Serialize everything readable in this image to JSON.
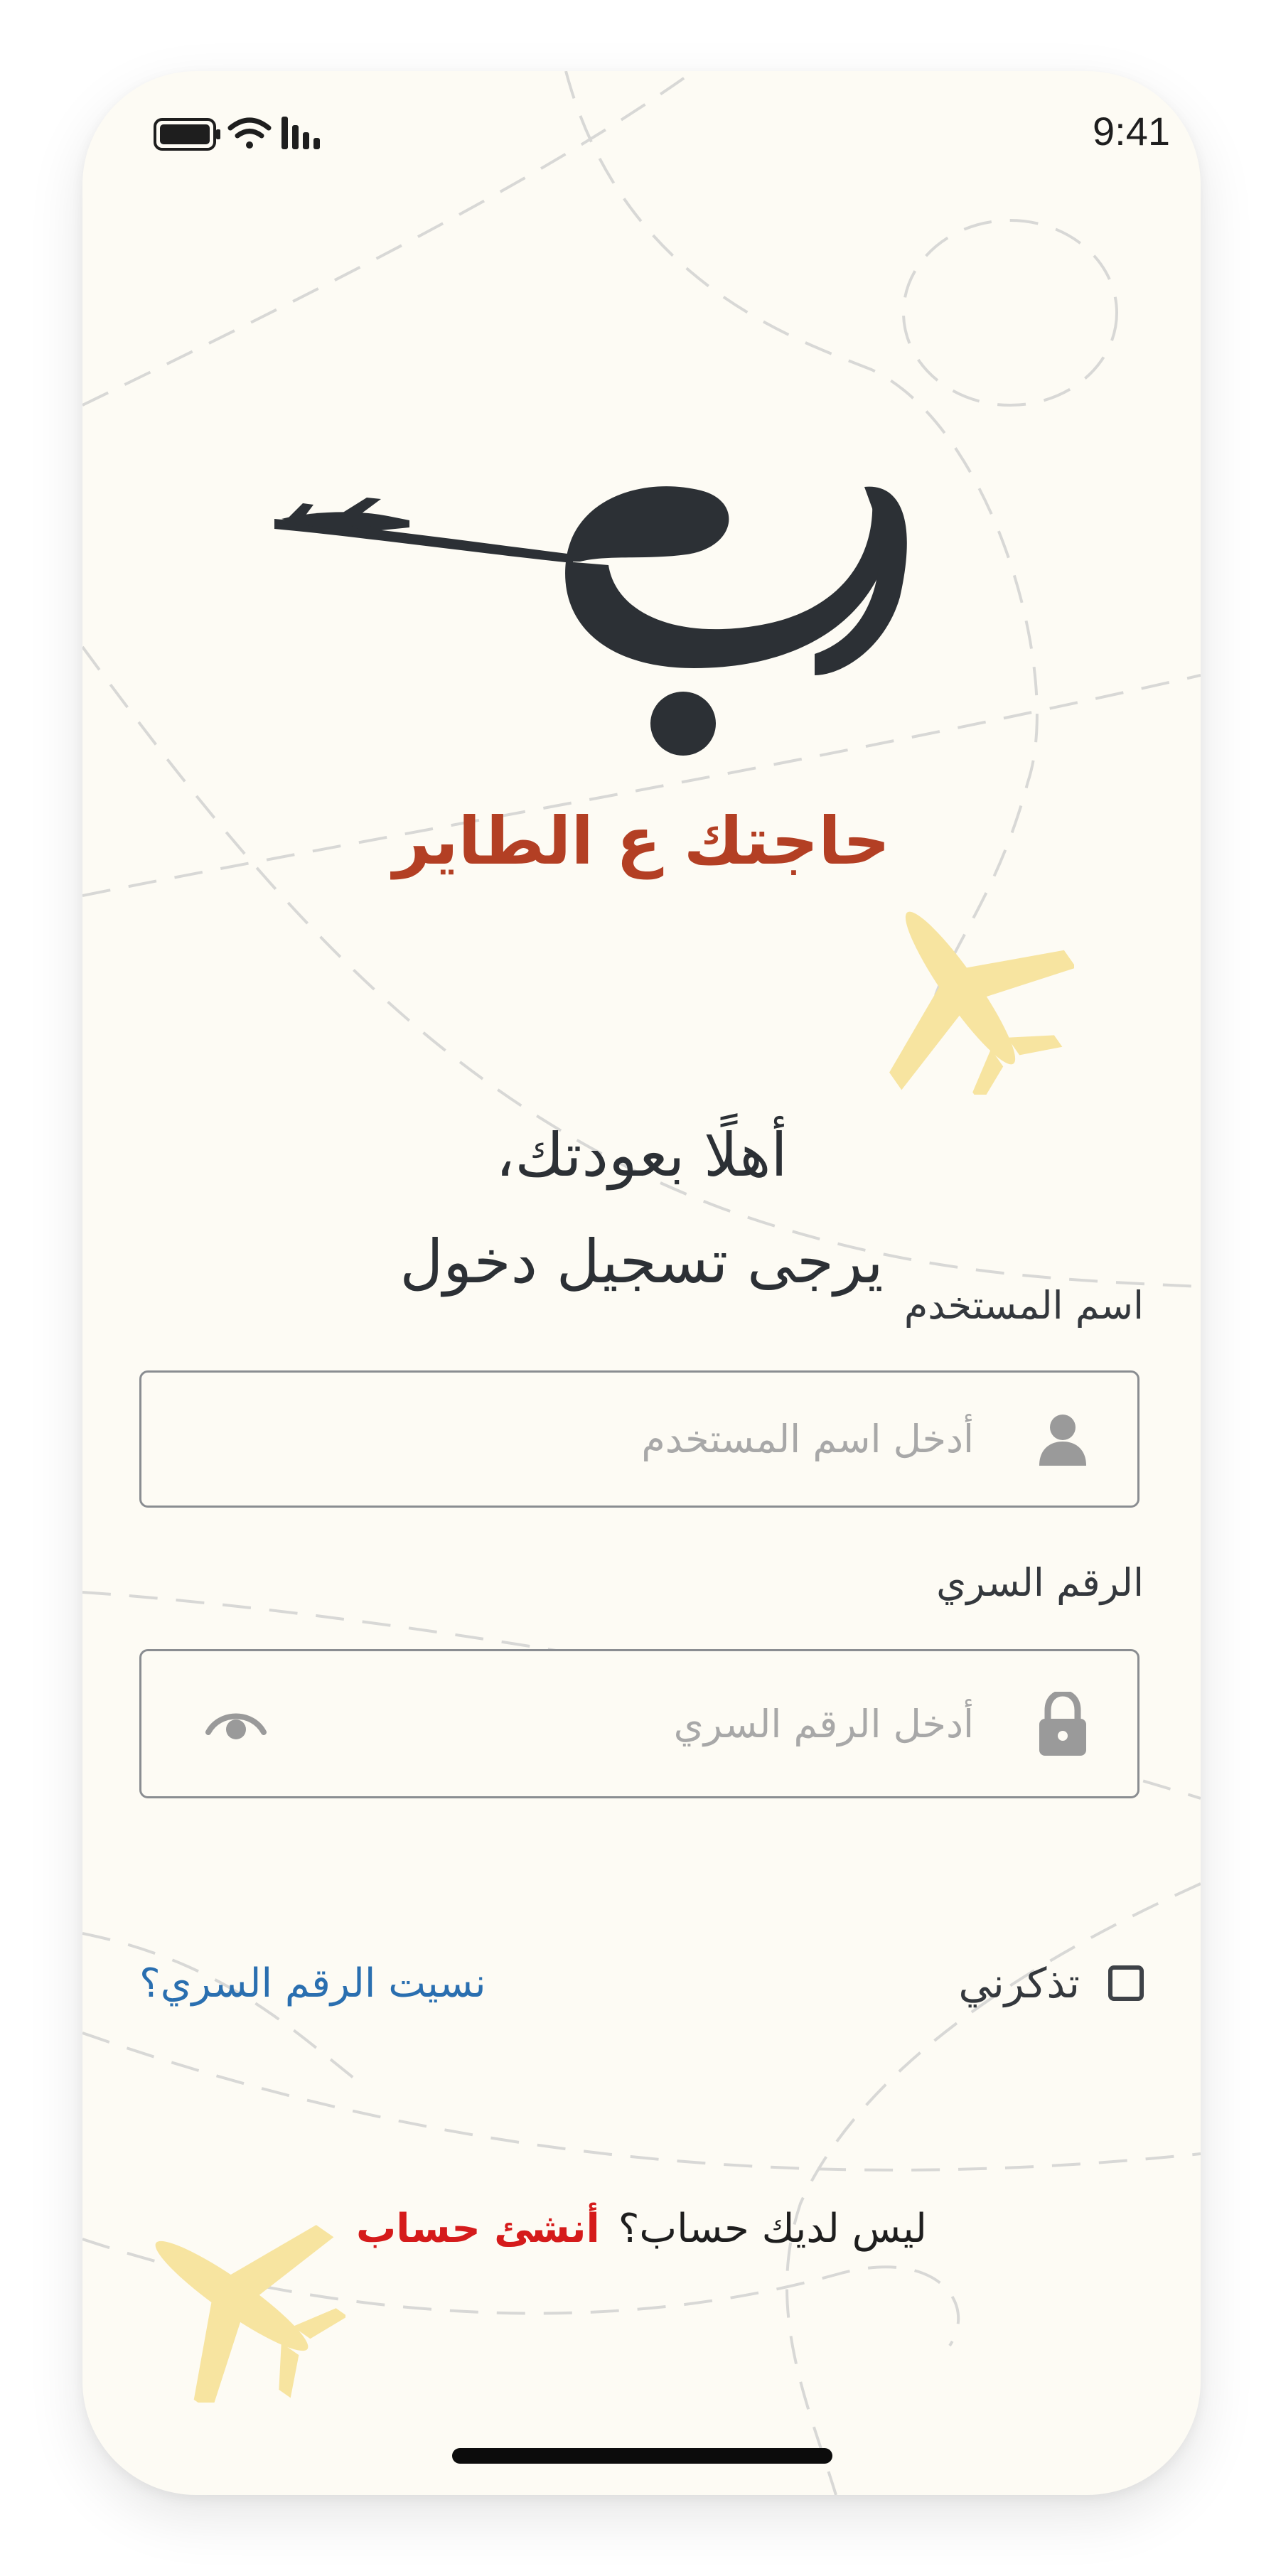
{
  "status_bar": {
    "time": "9:41",
    "icons": [
      "battery-icon",
      "wifi-icon",
      "signal-icon"
    ]
  },
  "brand": {
    "tagline": "حاجتك ع الطاير",
    "logo_color": "#2c3035",
    "tagline_color": "#b33f24"
  },
  "welcome": {
    "line1": "أهلًا بعودتك،",
    "line2": "يرجى تسجيل دخول"
  },
  "username": {
    "label": "اسم المستخدم",
    "placeholder": "أدخل اسم المستخدم",
    "value": "",
    "icon": "user-icon"
  },
  "password": {
    "label": "الرقم السري",
    "placeholder": "أدخل الرقم السري",
    "value": "",
    "icon": "lock-icon",
    "toggle_icon": "eye-icon"
  },
  "remember_me": {
    "label": "تذكرني",
    "checked": false
  },
  "forgot_password": "نسيت الرقم السري؟",
  "signup": {
    "question": "ليس لديك حساب؟",
    "link": "أنشئ حساب",
    "link_color": "#d51b1b"
  },
  "colors": {
    "background": "#fdfbf4",
    "accent_link": "#2a6fb0",
    "plane_decor": "#f7e4a0"
  }
}
